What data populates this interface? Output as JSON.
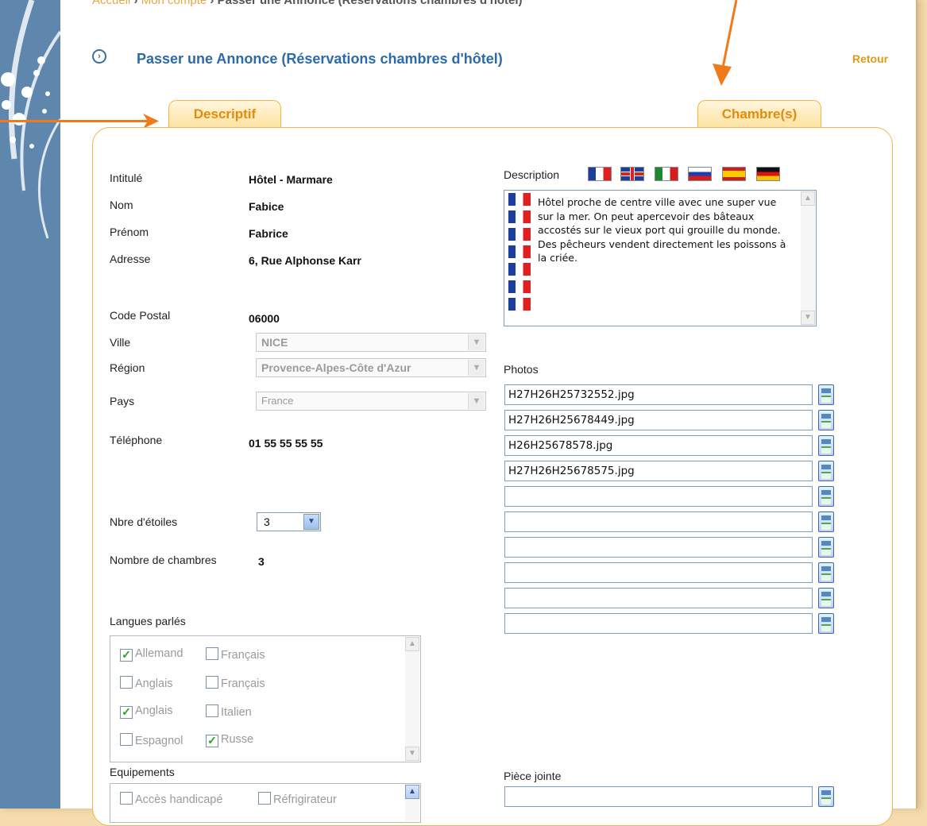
{
  "breadcrumb": {
    "home": "Accueil",
    "account": "Mon compte",
    "current": "Passer une Annonce (Réservations chambres d'hôtel)"
  },
  "page": {
    "title": "Passer une Annonce (Réservations chambres d'hôtel)",
    "back": "Retour"
  },
  "tabs": [
    {
      "label": "Descriptif"
    },
    {
      "label": "Chambre(s)"
    }
  ],
  "form": {
    "intitule": {
      "label": "Intitulé",
      "value": "Hôtel - Marmare"
    },
    "nom": {
      "label": "Nom",
      "value": "Fabice"
    },
    "prenom": {
      "label": "Prénom",
      "value": "Fabrice"
    },
    "adresse": {
      "label": "Adresse",
      "value": "6, Rue Alphonse Karr"
    },
    "code_postal": {
      "label": "Code Postal",
      "value": "06000"
    },
    "ville": {
      "label": "Ville",
      "value": "NICE"
    },
    "region": {
      "label": "Région",
      "value": "Provence-Alpes-Côte d'Azur"
    },
    "pays": {
      "label": "Pays",
      "value": "France"
    },
    "telephone": {
      "label": "Téléphone",
      "value": "01 55 55 55 55"
    },
    "etoiles": {
      "label": "Nbre d'étoiles",
      "value": "3"
    },
    "chambres": {
      "label": "Nombre de chambres",
      "value": "3"
    }
  },
  "description": {
    "label": "Description",
    "flags": [
      "fr-flag",
      "gb-flag",
      "it-flag",
      "ru-flag",
      "es-flag",
      "de-flag"
    ],
    "text": "Hôtel proche de centre ville avec une super vue sur la mer. On peut apercevoir des bâteaux accostés sur le vieux port qui grouille du monde. Des pêcheurs vendent directement les poissons à la criée."
  },
  "photos": {
    "label": "Photos",
    "files": [
      "H27H26H25732552.jpg",
      "H27H26H25678449.jpg",
      "H26H25678578.jpg",
      "H27H26H25678575.jpg",
      "",
      "",
      "",
      "",
      "",
      ""
    ]
  },
  "langues": {
    "label": "Langues parlés",
    "items": [
      {
        "label": "Allemand",
        "checked": true
      },
      {
        "label": "Français",
        "checked": false
      },
      {
        "label": "Anglais",
        "checked": false
      },
      {
        "label": "Français",
        "checked": false
      },
      {
        "label": "Anglais",
        "checked": true
      },
      {
        "label": "Italien",
        "checked": false
      },
      {
        "label": "Espagnol",
        "checked": false
      },
      {
        "label": "Russe",
        "checked": true
      }
    ]
  },
  "equipements": {
    "label": "Equipements",
    "items": [
      {
        "label": "Accès handicapé",
        "checked": false
      },
      {
        "label": "Réfrigirateur",
        "checked": false
      }
    ]
  },
  "piece_jointe": {
    "label": "Pièce jointe",
    "value": ""
  },
  "colors": {
    "accent": "#e58a0a",
    "title": "#2d6aa8",
    "sidebar": "#5f87ad",
    "arrow": "#f07a1a"
  }
}
